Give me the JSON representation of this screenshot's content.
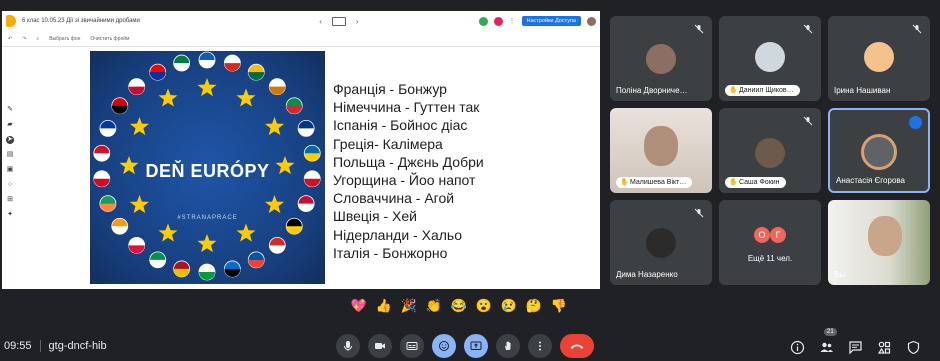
{
  "presentation": {
    "doc_title": "6 клас 10.05.23 Дії зі звичайними дробами",
    "share_label": "Настройки Доступа",
    "tools": [
      "Выбрать фон",
      "Очистить фрейм"
    ],
    "slide": {
      "banner_title": "DEŇ EURÓPY",
      "banner_tag": "#STRANAPRACE",
      "lines": [
        "Франція  - Бонжур",
        "Німеччина - Гуттен так",
        "Іспанія - Бойнос діас",
        "Греція- Калімера",
        "Польща - Джєнь Добри",
        "Угорщина - Йоо напот",
        "Словаччина - Агой",
        "Швеція - Хей",
        "Нідерланди - Хальо",
        "Італія - Бонжорно"
      ]
    }
  },
  "participants": [
    {
      "name": "Поліна Дворниче…",
      "style": "plain",
      "muted": true
    },
    {
      "name": "Даниил Щиков…",
      "style": "pill",
      "muted": true
    },
    {
      "name": "Ірина Нашиван",
      "style": "plain",
      "muted": true
    },
    {
      "name": "Малишева Вікт…",
      "style": "pill",
      "muted": false
    },
    {
      "name": "Саша Фокин",
      "style": "pill",
      "muted": true
    },
    {
      "name": "Анастасія Єгорова",
      "style": "plain",
      "speaking": true
    },
    {
      "name": "Дима Назаренко",
      "style": "plain",
      "muted": true
    },
    {
      "name": "Ещё 11 чел.",
      "style": "more",
      "initials": [
        "О",
        "Г"
      ]
    },
    {
      "name": "Вы",
      "style": "plain"
    }
  ],
  "reactions": [
    "💖",
    "👍",
    "🎉",
    "👏",
    "😂",
    "😮",
    "😢",
    "🤔",
    "👎"
  ],
  "meeting": {
    "time": "09:55",
    "code": "gtg-dncf-hib",
    "participants_badge": "21"
  },
  "colors": {
    "background": "#202124",
    "tile": "#3c4043",
    "accent": "#8ab4f8",
    "end_call": "#ea4335"
  }
}
